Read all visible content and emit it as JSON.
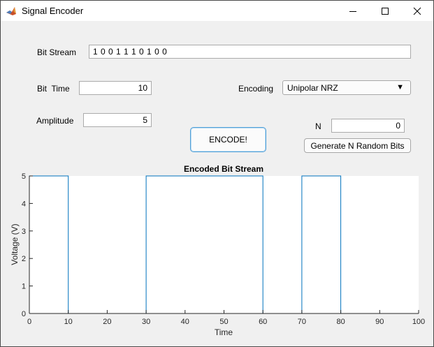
{
  "window": {
    "title": "Signal Encoder"
  },
  "form": {
    "bit_stream_label": "Bit Stream",
    "bit_stream_value": "1 0 0 1 1 1 0 1 0 0",
    "bit_time_label": "Bit  Time",
    "bit_time_value": "10",
    "amplitude_label": "Amplitude",
    "amplitude_value": "5",
    "encoding_label": "Encoding",
    "encoding_value": "Unipolar NRZ",
    "n_label": "N",
    "n_value": "0",
    "encode_button_label": "ENCODE!",
    "generate_button_label": "Generate N Random Bits"
  },
  "chart_data": {
    "type": "line",
    "title": "Encoded Bit Stream",
    "xlabel": "Time",
    "ylabel": "Voltage (V)",
    "xlim": [
      0,
      100
    ],
    "ylim": [
      0,
      5
    ],
    "xticks": [
      0,
      10,
      20,
      30,
      40,
      50,
      60,
      70,
      80,
      90,
      100
    ],
    "yticks": [
      0,
      1,
      2,
      3,
      4,
      5
    ],
    "grid": false,
    "line_color": "#0072bd",
    "series": [
      {
        "x": [
          0,
          0,
          10,
          10,
          30,
          30,
          60,
          60,
          70,
          70,
          80,
          80,
          100
        ],
        "y": [
          0,
          5,
          5,
          0,
          0,
          5,
          5,
          0,
          0,
          5,
          5,
          0,
          0
        ]
      }
    ]
  }
}
